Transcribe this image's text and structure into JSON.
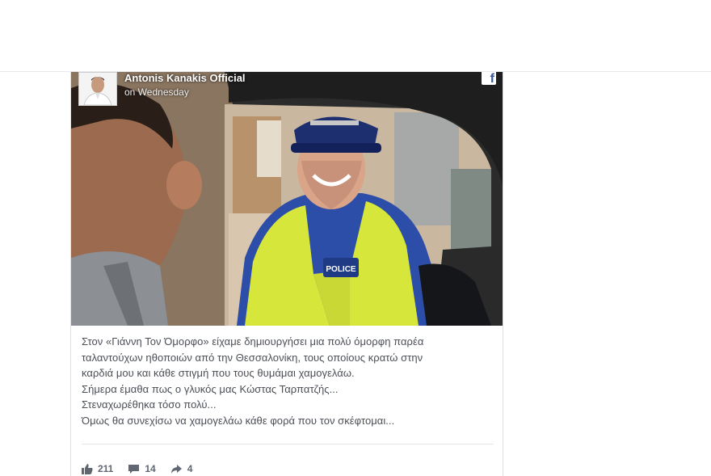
{
  "post": {
    "page_name": "Antonis Kanakis Official",
    "time": "on Wednesday",
    "brand_badge": "f",
    "text_lines": [
      "Στον «Γιάννη Τον Όμορφο» είχαμε δημιουργήσει μια πολύ όμορφη παρέα",
      "ταλαντούχων ηθοποιών από την Θεσσαλονίκη, τους οποίους κρατώ στην",
      "καρδιά μου και κάθε στιγμή που τους θυμάμαι χαμογελάω.",
      "Σήμερα έμαθα πως ο γλυκός μας Κώστας Ταρπατζής...",
      "Στεναχωρέθηκα τόσο πολύ...",
      "Όμως θα συνεχίσω να χαμογελάω κάθε φορά που τον σκέφτομαι..."
    ],
    "image_caption_text": "POLICE",
    "stats": {
      "likes": "211",
      "comments": "14",
      "shares": "4"
    }
  },
  "icons": {
    "like": "thumbs-up-icon",
    "comment": "comment-bubble-icon",
    "share": "share-arrow-icon",
    "facebook": "facebook-logo-icon"
  },
  "colors": {
    "text": "#4b4f56",
    "stats": "#606770",
    "facebook_blue": "#3b5998"
  }
}
